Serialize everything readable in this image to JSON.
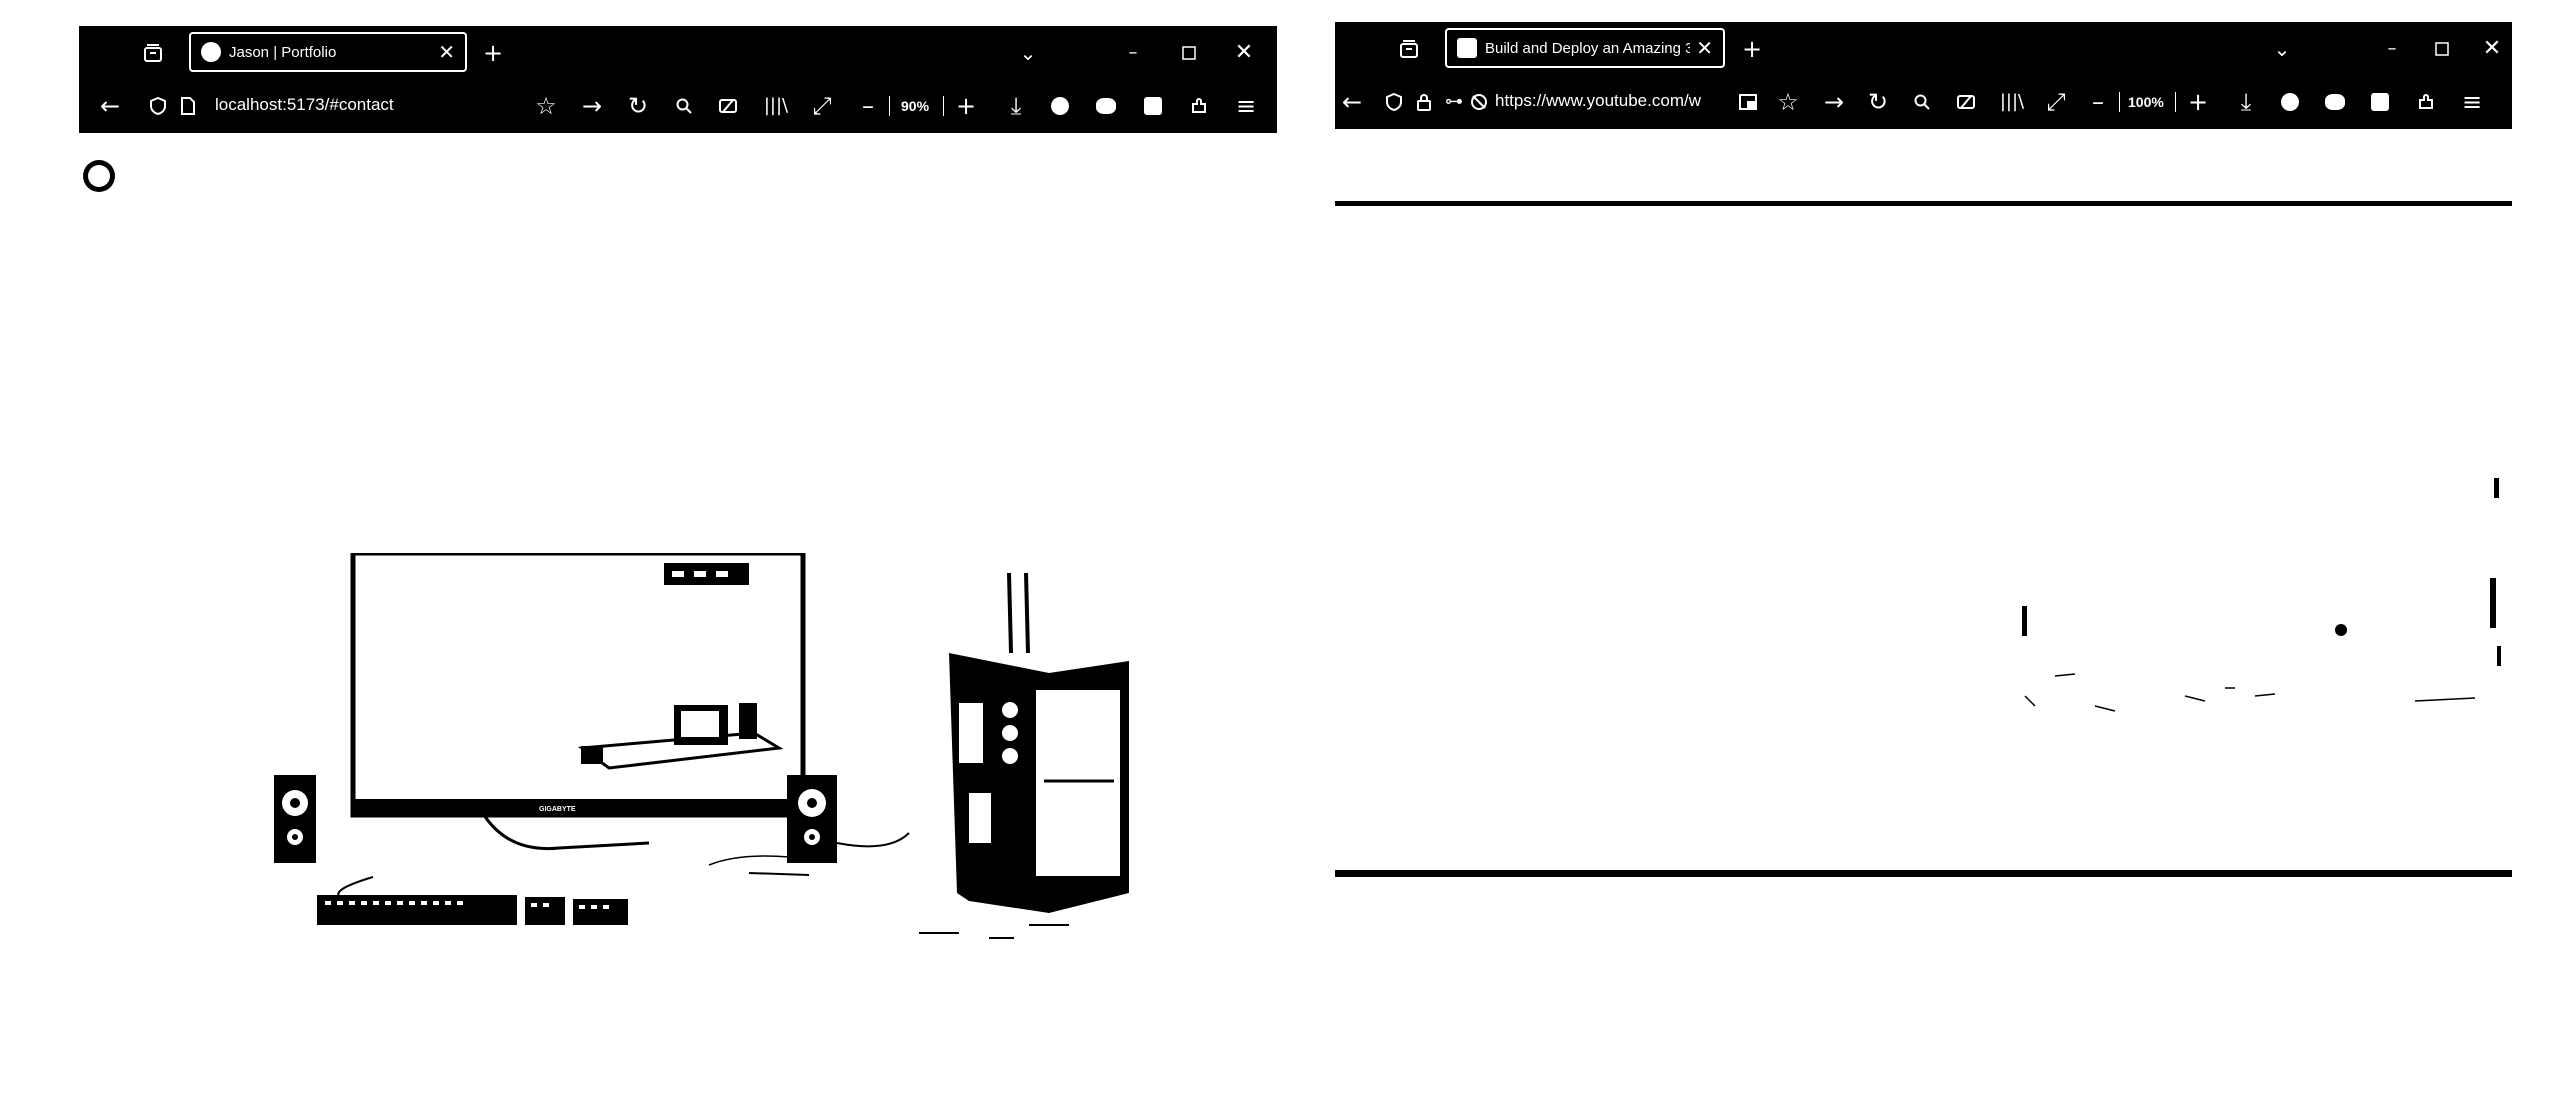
{
  "left_browser": {
    "tab": {
      "title": "Jason | Portfolio",
      "favicon": "portfolio-logo-icon"
    },
    "url": "localhost:5173/#contact",
    "zoom": "90%"
  },
  "right_browser": {
    "tab": {
      "title": "Build and Deploy an Amazing 3",
      "favicon": "youtube-tab-icon"
    },
    "url": "https://www.youtube.com/w",
    "zoom": "100%"
  },
  "scene": {
    "monitor_brand": "GIGABYTE"
  },
  "colors": {
    "chrome": "#000000",
    "page": "#ffffff"
  }
}
